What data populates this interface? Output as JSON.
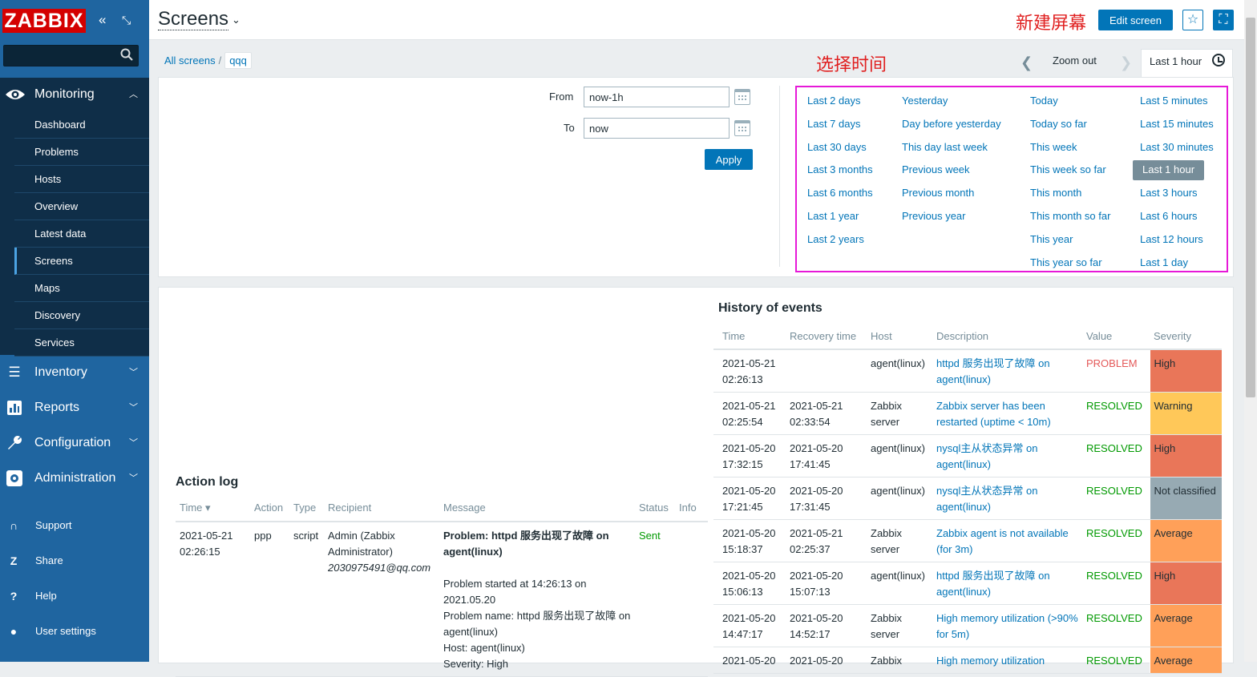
{
  "sidebar": {
    "logo": "ZABBIX",
    "collapse_glyph": "«",
    "kiosk_glyph": "⤡",
    "search_placeholder": "",
    "monitoring": {
      "label": "Monitoring",
      "icon": "eye-icon",
      "items": [
        "Dashboard",
        "Problems",
        "Hosts",
        "Overview",
        "Latest data",
        "Screens",
        "Maps",
        "Discovery",
        "Services"
      ],
      "active": "Screens"
    },
    "main_menu": [
      {
        "label": "Inventory",
        "icon": "list-icon"
      },
      {
        "label": "Reports",
        "icon": "bar-chart-icon"
      },
      {
        "label": "Configuration",
        "icon": "wrench-icon"
      },
      {
        "label": "Administration",
        "icon": "gear-icon"
      }
    ],
    "bottom_menu": [
      {
        "label": "Support",
        "icon": "headset-icon",
        "glyph": "∩"
      },
      {
        "label": "Share",
        "icon": "share-icon",
        "glyph": "Z"
      },
      {
        "label": "Help",
        "icon": "help-icon",
        "glyph": "?"
      },
      {
        "label": "User settings",
        "icon": "user-icon",
        "glyph": "●"
      }
    ]
  },
  "header": {
    "title": "Screens",
    "annotation_new": "新建屏幕",
    "edit_button": "Edit screen",
    "favorite_icon": "star-icon",
    "fullscreen_icon": "fullscreen-icon"
  },
  "breadcrumb": {
    "root": "All screens",
    "separator": "/",
    "current": "qqq"
  },
  "annotation_time": "选择时间",
  "timeframe": {
    "zoom_out": "Zoom out",
    "tab_label": "Last 1 hour",
    "from_label": "From",
    "from_value": "now-1h",
    "to_label": "To",
    "to_value": "now",
    "apply": "Apply",
    "quick": [
      [
        "Last 2 days",
        "Last 7 days",
        "Last 30 days",
        "Last 3 months",
        "Last 6 months",
        "Last 1 year",
        "Last 2 years"
      ],
      [
        "Yesterday",
        "Day before yesterday",
        "This day last week",
        "Previous week",
        "Previous month",
        "Previous year"
      ],
      [
        "Today",
        "Today so far",
        "This week",
        "This week so far",
        "This month",
        "This month so far",
        "This year",
        "This year so far"
      ],
      [
        "Last 5 minutes",
        "Last 15 minutes",
        "Last 30 minutes",
        "Last 1 hour",
        "Last 3 hours",
        "Last 6 hours",
        "Last 12 hours",
        "Last 1 day"
      ]
    ],
    "selected": "Last 1 hour"
  },
  "action_log": {
    "title": "Action log",
    "columns": [
      "Time ▾",
      "Action",
      "Type",
      "Recipient",
      "Message",
      "Status",
      "Info"
    ],
    "row": {
      "date": "2021-05-21",
      "time": "02:26:15",
      "action": "ppp",
      "type": "script",
      "recipient": "Admin (Zabbix Administrator)",
      "recipient_email": "2030975491@qq.com",
      "message_title": "Problem: httpd 服务出现了故障 on agent(linux)",
      "message_lines": [
        "Problem started at 14:26:13 on 2021.05.20",
        "Problem name: httpd 服务出现了故障 on agent(linux)",
        "Host: agent(linux)",
        "Severity: High"
      ],
      "status": "Sent"
    }
  },
  "history": {
    "title": "History of events",
    "columns": [
      "Time",
      "Recovery time",
      "Host",
      "Description",
      "Value",
      "Severity"
    ],
    "rows": [
      {
        "t1": "2021-05-21",
        "t2": "02:26:13",
        "r1": "",
        "r2": "",
        "host": "agent(linux)",
        "desc": "httpd 服务出现了故障 on agent(linux)",
        "value": "PROBLEM",
        "sev": "High",
        "sev_color": "#e97659"
      },
      {
        "t1": "2021-05-21",
        "t2": "02:25:54",
        "r1": "2021-05-21",
        "r2": "02:33:54",
        "host": "Zabbix server",
        "desc": "Zabbix server has been restarted (uptime < 10m)",
        "value": "RESOLVED",
        "sev": "Warning",
        "sev_color": "#ffc859"
      },
      {
        "t1": "2021-05-20",
        "t2": "17:32:15",
        "r1": "2021-05-20",
        "r2": "17:41:45",
        "host": "agent(linux)",
        "desc": "nysql主从状态异常 on agent(linux)",
        "value": "RESOLVED",
        "sev": "High",
        "sev_color": "#e97659"
      },
      {
        "t1": "2021-05-20",
        "t2": "17:21:45",
        "r1": "2021-05-20",
        "r2": "17:31:45",
        "host": "agent(linux)",
        "desc": "nysql主从状态异常 on agent(linux)",
        "value": "RESOLVED",
        "sev": "Not classified",
        "sev_color": "#97aab3"
      },
      {
        "t1": "2021-05-20",
        "t2": "15:18:37",
        "r1": "2021-05-21",
        "r2": "02:25:37",
        "host": "Zabbix server",
        "desc": "Zabbix agent is not available (for 3m)",
        "value": "RESOLVED",
        "sev": "Average",
        "sev_color": "#ffa059"
      },
      {
        "t1": "2021-05-20",
        "t2": "15:06:13",
        "r1": "2021-05-20",
        "r2": "15:07:13",
        "host": "agent(linux)",
        "desc": "httpd 服务出现了故障 on agent(linux)",
        "value": "RESOLVED",
        "sev": "High",
        "sev_color": "#e97659"
      },
      {
        "t1": "2021-05-20",
        "t2": "14:47:17",
        "r1": "2021-05-20",
        "r2": "14:52:17",
        "host": "Zabbix server",
        "desc": "High memory utilization (>90% for 5m)",
        "value": "RESOLVED",
        "sev": "Average",
        "sev_color": "#ffa059"
      },
      {
        "t1": "2021-05-20",
        "t2": "",
        "r1": "2021-05-20",
        "r2": "",
        "host": "Zabbix",
        "desc": "High memory utilization",
        "value": "RESOLVED",
        "sev": "Average",
        "sev_color": "#ffa059"
      }
    ]
  }
}
